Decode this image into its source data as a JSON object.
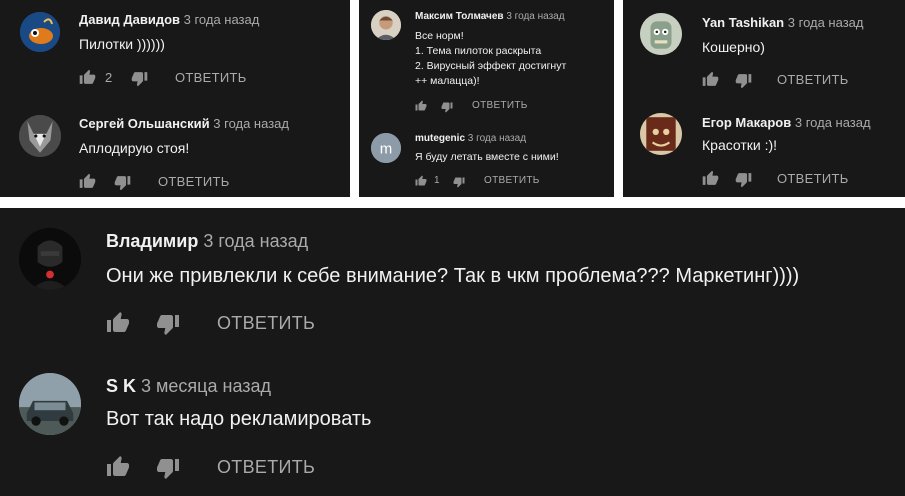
{
  "colors": {
    "panel_bg": "#181818",
    "author": "#f1f1f1",
    "text": "#f1f1f1",
    "meta": "#aaaaaa",
    "icon": "#909090"
  },
  "icons": {
    "like": "thumb-up-icon",
    "dislike": "thumb-down-icon"
  },
  "panels": [
    {
      "comments": [
        {
          "author": "Давид Давидов",
          "time": "3 года назад",
          "lines": [
            "Пилотки ))))))"
          ],
          "likes": "2",
          "reply": "ОТВЕТИТЬ"
        },
        {
          "author": "Сергей Ольшанский",
          "time": "3 года назад",
          "lines": [
            "Аплодирую стоя!"
          ],
          "likes": "",
          "reply": "ОТВЕТИТЬ"
        }
      ]
    },
    {
      "comments": [
        {
          "author": "Максим Толмачев",
          "time": "3 года назад",
          "lines": [
            "Все норм!",
            "1. Тема пилоток раскрыта",
            "2. Вирусный эффект достигнут",
            "++ малацца)!"
          ],
          "likes": "",
          "reply": "ОТВЕТИТЬ"
        },
        {
          "author": "mutegenic",
          "time": "3 года назад",
          "avatar_letter": "m",
          "lines": [
            "Я буду летать вместе с ними!"
          ],
          "likes": "1",
          "reply": "ОТВЕТИТЬ"
        }
      ]
    },
    {
      "comments": [
        {
          "author": "Yan Tashikan",
          "time": "3 года назад",
          "lines": [
            "Кошерно)"
          ],
          "likes": "",
          "reply": "ОТВЕТИТЬ"
        },
        {
          "author": "Егор Макаров",
          "time": "3 года назад",
          "lines": [
            "Красотки :)!"
          ],
          "likes": "",
          "reply": "ОТВЕТИТЬ"
        }
      ]
    },
    {
      "comments": [
        {
          "author": "Владимир",
          "time": "3 года назад",
          "lines": [
            "Они же привлекли к себе внимание? Так в чкм проблема??? Маркетинг))))"
          ],
          "likes": "",
          "reply": "ОТВЕТИТЬ"
        },
        {
          "author": "S K",
          "time": "3 месяца назад",
          "lines": [
            "Вот так надо рекламировать"
          ],
          "likes": "",
          "reply": "ОТВЕТИТЬ"
        }
      ]
    }
  ]
}
